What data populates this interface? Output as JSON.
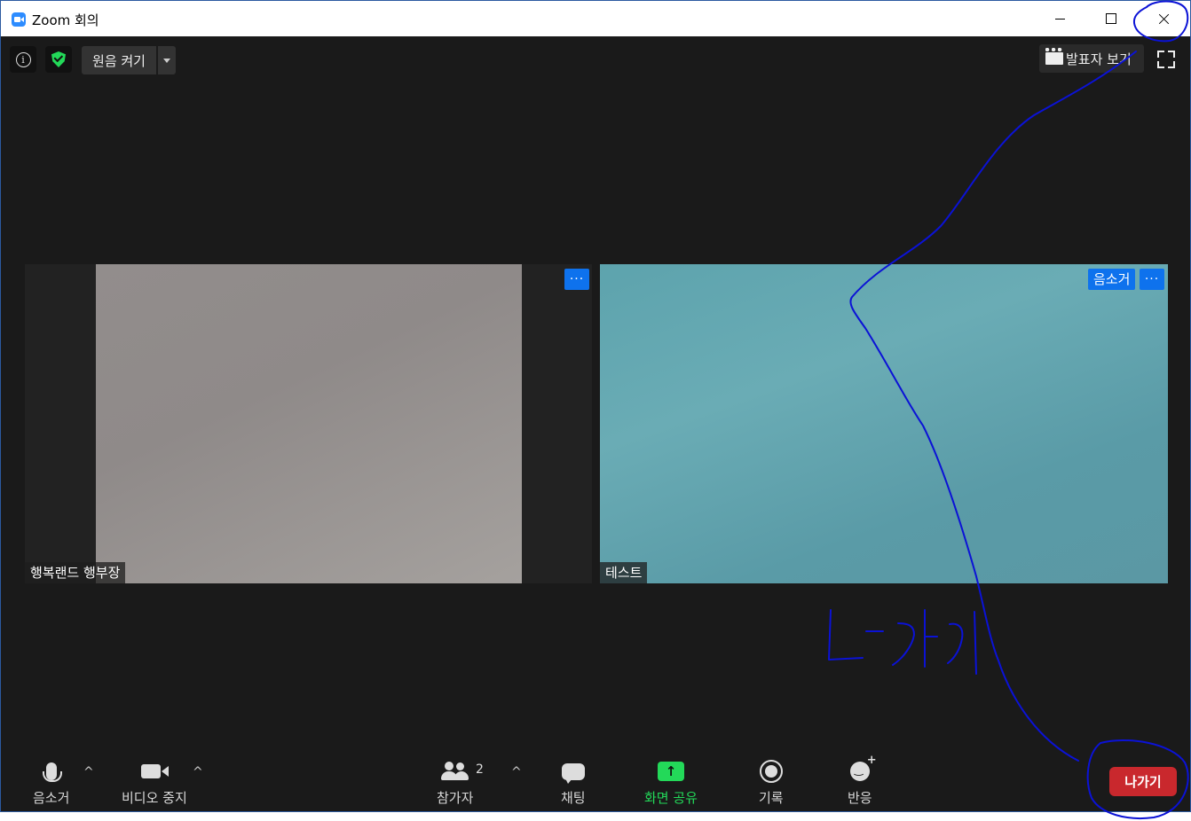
{
  "window": {
    "title": "Zoom 회의",
    "controls": {
      "minimize": "minimize-icon",
      "maximize": "maximize-icon",
      "close": "close-icon"
    }
  },
  "topbar": {
    "info_icon": "info-icon",
    "security_icon": "shield-icon",
    "original_sound_label": "원음 켜기",
    "speaker_view_label": "발표자 보기",
    "fullscreen_icon": "fullscreen-icon"
  },
  "participants": [
    {
      "name": "행복랜드 행부장",
      "more_label": "···"
    },
    {
      "name": "테스트",
      "muted_label": "음소거",
      "more_label": "···"
    }
  ],
  "toolbar": {
    "mute_label": "음소거",
    "video_label": "비디오 중지",
    "participants_label": "참가자",
    "participants_count": "2",
    "chat_label": "채팅",
    "share_label": "화면 공유",
    "record_label": "기록",
    "reactions_label": "반응",
    "leave_label": "나가기",
    "caret_up": "^"
  },
  "annotation": {
    "handwritten_text": "나가기",
    "color": "#0b12d6"
  },
  "colors": {
    "accent_blue": "#0e72ed",
    "share_green": "#23d959",
    "leave_red": "#c9282d",
    "background": "#1a1a1a"
  }
}
